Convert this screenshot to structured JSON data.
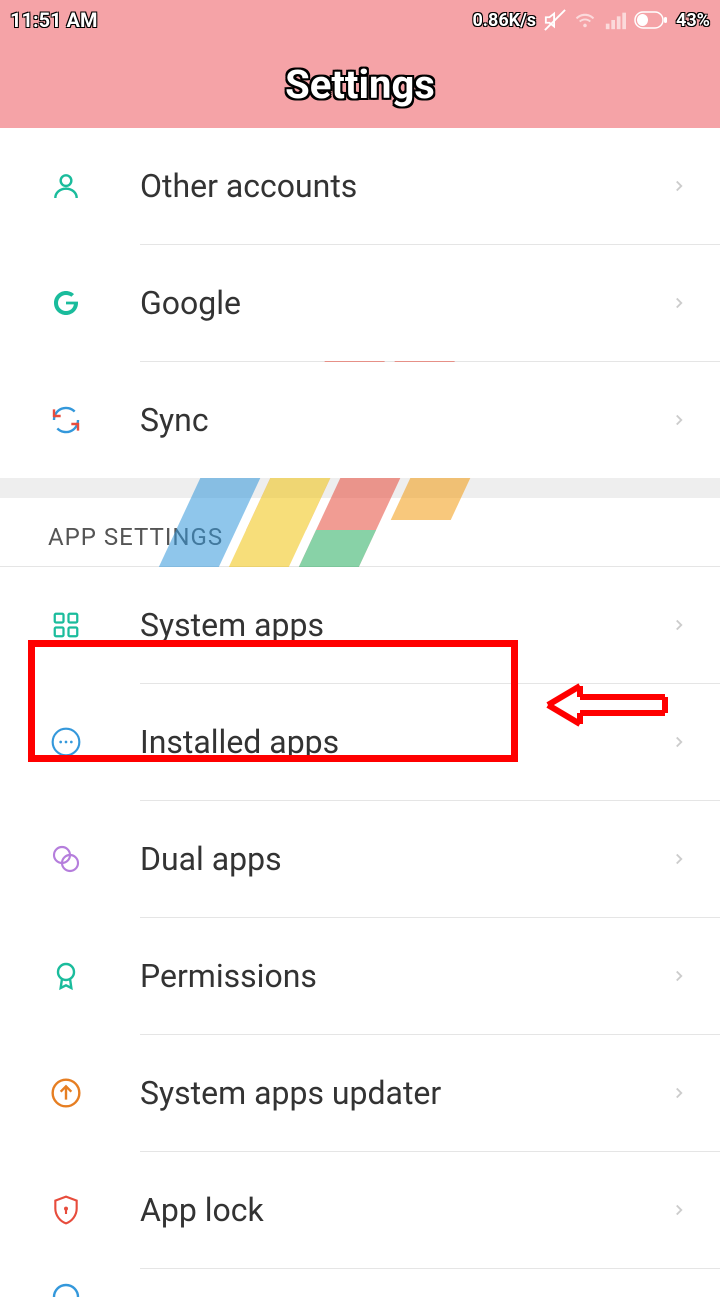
{
  "status": {
    "time": "11:51 AM",
    "speed": "0.86K/s",
    "battery": "43%"
  },
  "header": {
    "title": "Settings"
  },
  "sections": {
    "accounts": {
      "other_accounts": "Other accounts",
      "google": "Google",
      "sync": "Sync"
    },
    "app_header": "APP SETTINGS",
    "apps": {
      "system_apps": "System apps",
      "installed_apps": "Installed apps",
      "dual_apps": "Dual apps",
      "permissions": "Permissions",
      "system_apps_updater": "System apps updater",
      "app_lock": "App lock"
    }
  },
  "highlight": {
    "target": "installed_apps"
  }
}
